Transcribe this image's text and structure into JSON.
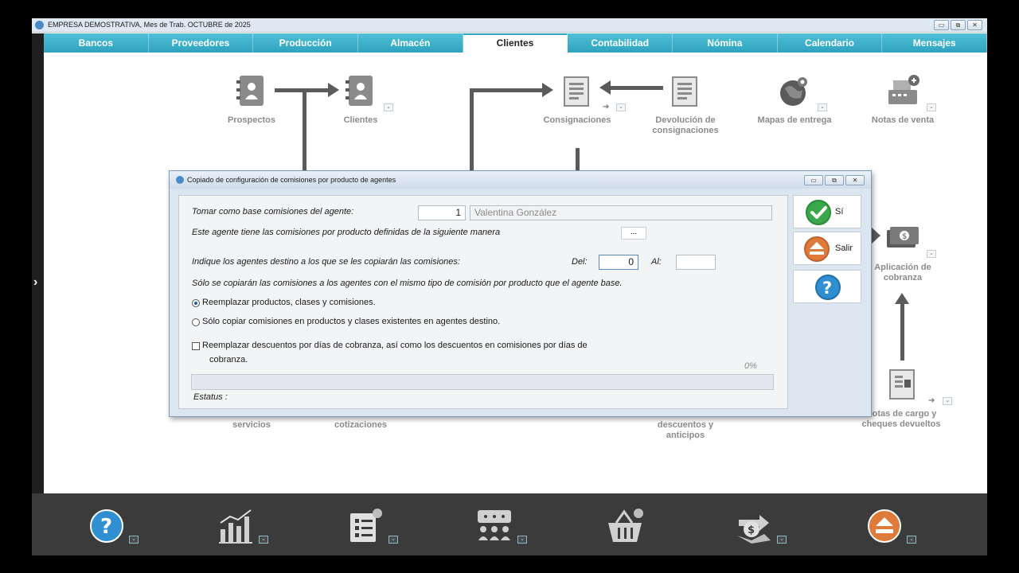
{
  "window": {
    "title": "EMPRESA DEMOSTRATIVA, Mes de Trab. OCTUBRE de 2025",
    "minimize": "▭",
    "restore": "⧉",
    "close": "✕"
  },
  "nav": {
    "tabs": [
      {
        "label": "Bancos"
      },
      {
        "label": "Proveedores"
      },
      {
        "label": "Producción"
      },
      {
        "label": "Almacén"
      },
      {
        "label": "Clientes",
        "active": true
      },
      {
        "label": "Contabilidad"
      },
      {
        "label": "Nómina"
      },
      {
        "label": "Calendario"
      },
      {
        "label": "Mensajes"
      }
    ]
  },
  "sidebar": {
    "toggle_icon": "chevron-right-icon",
    "toggle_glyph": "›"
  },
  "flow": {
    "prospectos": "Prospectos",
    "clientes": "Clientes",
    "consignaciones": "Consignaciones",
    "devolucion_line1": "Devolución de",
    "devolucion_line2": "consignaciones",
    "mapas": "Mapas de entrega",
    "notas_venta": "Notas de venta",
    "aplicacion_line1": "Aplicación de",
    "aplicacion_line2": "cobranza",
    "servicios": "servicios",
    "cotizaciones": "cotizaciones",
    "descuentos_line1": "descuentos y",
    "descuentos_line2": "anticipos",
    "notas_cargo_line1": "Notas de cargo y",
    "notas_cargo_line2": "cheques devueltos",
    "dropdown_glyph": "⌄",
    "arrow_glyph": "➔"
  },
  "dialog": {
    "title": "Copiado de configuración de comisiones por producto de agentes",
    "base_agent_label": "Tomar como base comisiones del agente:",
    "base_agent_number": "1",
    "base_agent_name": "Valentina González",
    "defined_label": "Este agente tiene las comisiones por producto definidas de la siguiente manera",
    "ellipsis_button": "...",
    "target_label": "Indique los agentes destino a los que se les copiarán las comisiones:",
    "del_label": "Del:",
    "del_value": "0",
    "al_label": "Al:",
    "al_value": "",
    "note": "Sólo se copiarán las comisiones a los agentes con el mismo tipo de comisión por producto que el agente base.",
    "radio_replace": "Reemplazar productos, clases y comisiones.",
    "radio_existing": "Sólo copiar comisiones en productos y clases existentes en agentes destino.",
    "check_line1": "Reemplazar  descuentos por días de cobranza, así como los descuentos  en comisiones  por días de",
    "check_line2": "cobranza.",
    "progress_pct": "0%",
    "progress_value": 0,
    "status_label": "Estatus :",
    "btn_si": "Sí",
    "btn_salir": "Salir",
    "help_glyph": "?"
  },
  "bottombar": {
    "help_glyph": "?"
  },
  "colors": {
    "nav": "#2ea3bf",
    "help_blue": "#2f8fd0",
    "exit_orange": "#e07a3a",
    "ok_green": "#3aa84a"
  }
}
